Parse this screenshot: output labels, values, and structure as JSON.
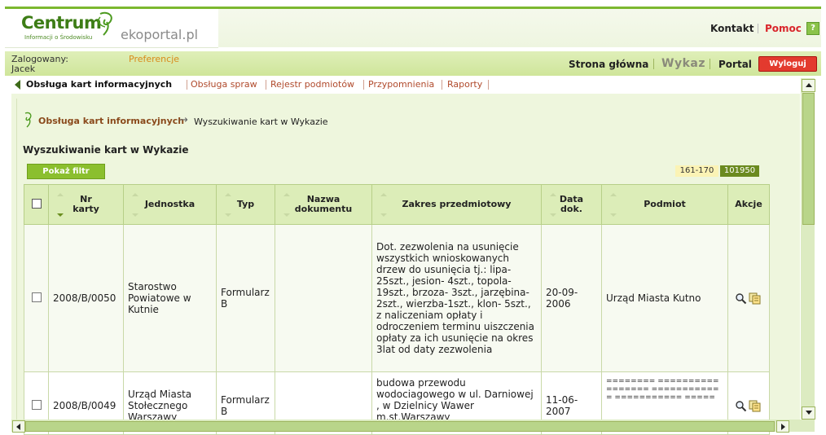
{
  "header": {
    "logo_name": "Centrum",
    "logo_subtitle": "Informacji o Środowisku",
    "logo_portal": "ekoportal.pl",
    "kontakt": "Kontakt",
    "pomoc": "Pomoc",
    "help_icon_label": "?"
  },
  "user": {
    "logged_label": "Zalogowany:",
    "name": "Jacek",
    "preferences": "Preferencje"
  },
  "nav": {
    "home": "Strona główna",
    "wykaz": "Wykaz",
    "portal": "Portal",
    "logout": "Wyloguj"
  },
  "tabs": [
    "Obsługa kart informacyjnych",
    "Obsługa spraw",
    "Rejestr podmiotów",
    "Przypomnienia",
    "Raporty"
  ],
  "breadcrumb": {
    "link": "Obsługa kart informacyjnych",
    "arrow": "→",
    "current": "Wyszukiwanie kart w Wykazie"
  },
  "page_title": "Wyszukiwanie kart w Wykazie",
  "filter_button": "Pokaż filtr",
  "pagination": {
    "range": "161-170",
    "total": "101950"
  },
  "table": {
    "headers": {
      "nr": "Nr\nkarty",
      "jednostka": "Jednostka",
      "typ": "Typ",
      "nazwa": "Nazwa\ndokumentu",
      "zakres": "Zakres przedmiotowy",
      "data": "Data\ndok.",
      "podmiot": "Podmiot",
      "akcje": "Akcje"
    },
    "rows": [
      {
        "nr": "2008/B/0050",
        "jednostka": "Starostwo Powiatowe w Kutnie",
        "typ": "Formularz B",
        "nazwa": "",
        "zakres": "Dot. zezwolenia na usunięcie wszystkich wnioskowanych drzew do usunięcia tj.: lipa-25szt., jesion- 4szt., topola-19szt., brzoza- 3szt., jarzębina- 2szt., wierzba-1szt., klon- 5szt., z naliczeniam opłaty i odroczeniem terminu uiszczenia opłaty za ich usunięcie na okres 3lat od daty zezwolenia",
        "data": "20-09-2006",
        "podmiot": "Urząd Miasta Kutno"
      },
      {
        "nr": "2008/B/0049",
        "jednostka": "Urząd Miasta Stołecznego Warszawy",
        "typ": "Formularz B",
        "nazwa": "",
        "zakres": "budowa przewodu wodociagowego w ul. Darniowej , w Dzielnicy Wawer m.st.Warszawy",
        "data": "11-06-2007",
        "podmiot": "======== ================= =========== = ===========  ====="
      }
    ]
  },
  "colors": {
    "brand_green": "#7cb82f",
    "header_bar": "#cfe59a",
    "logout_red": "#e33a2e",
    "pomoc_red": "#d9262b",
    "total_badge": "#6b8a1f"
  }
}
